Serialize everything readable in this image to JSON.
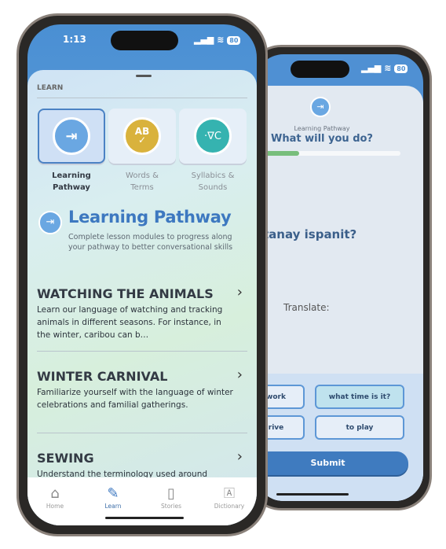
{
  "back_phone": {
    "status": {
      "battery": "80"
    },
    "subtitle": "Learning Pathway",
    "title": "What will you do?",
    "progress_percent": 30,
    "phrase": "tanay ispanit?",
    "translate_label": "Translate:",
    "options": [
      "work",
      "what time is it?",
      "rive",
      "to play"
    ],
    "selected_option": "what time is it?",
    "submit_label": "Submit",
    "colors": {
      "accent": "#3f7bbf",
      "progress": "#78be7c"
    }
  },
  "front_phone": {
    "status": {
      "time": "1:13",
      "battery": "80"
    },
    "section_label": "LEARN",
    "categories": [
      {
        "label": "Learning Pathway",
        "icon": "signpost-icon",
        "color": "#6aa7e2",
        "selected": true
      },
      {
        "label": "Words & Terms",
        "icon": "ab-check-icon",
        "glyph": "AB",
        "color": "#d9b23c",
        "selected": false
      },
      {
        "label": "Syllabics & Sounds",
        "icon": "syllabics-icon",
        "glyph": "·∇C",
        "color": "#35b3b0",
        "selected": false
      }
    ],
    "header": {
      "title": "Learning Pathway",
      "description": "Complete lesson modules to progress along your pathway to better conversational skills"
    },
    "lessons": [
      {
        "title": "WATCHING THE ANIMALS",
        "description": "Learn our language of watching and tracking animals in different seasons. For instance, in the winter, caribou can b…"
      },
      {
        "title": "WINTER CARNIVAL",
        "description": "Familiarize yourself with the language of winter celebrations and familial gatherings."
      },
      {
        "title": "SEWING",
        "description": "Understand the terminology used around"
      }
    ],
    "tabs": [
      {
        "label": "Home",
        "icon": "home-icon",
        "active": false
      },
      {
        "label": "Learn",
        "icon": "pencil-icon",
        "active": true
      },
      {
        "label": "Stories",
        "icon": "book-icon",
        "active": false
      },
      {
        "label": "Dictionary",
        "icon": "dictionary-icon",
        "active": false
      }
    ]
  }
}
